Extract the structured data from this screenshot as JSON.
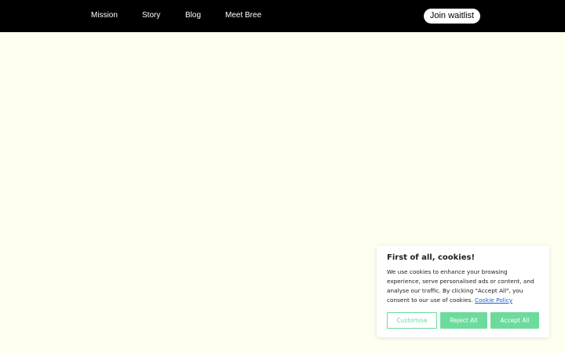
{
  "nav": {
    "items": [
      {
        "label": "Mission"
      },
      {
        "label": "Story"
      },
      {
        "label": "Blog"
      },
      {
        "label": "Meet Bree"
      }
    ],
    "cta_label": "Join waitlist"
  },
  "cookie_banner": {
    "title": "First of all, cookies!",
    "body": "We use cookies to enhance your browsing experience, serve personalised ads or content, and analyse our traffic. By clicking \"Accept All\", you consent to our use of cookies.",
    "policy_link": "Cookie Policy",
    "buttons": {
      "customise": "Customise",
      "reject": "Reject All",
      "accept": "Accept All"
    }
  },
  "colors": {
    "header_bg": "#000000",
    "page_bg": "#fefff0",
    "accent_green": "#6cdb9c",
    "link_blue": "#1863dc"
  }
}
